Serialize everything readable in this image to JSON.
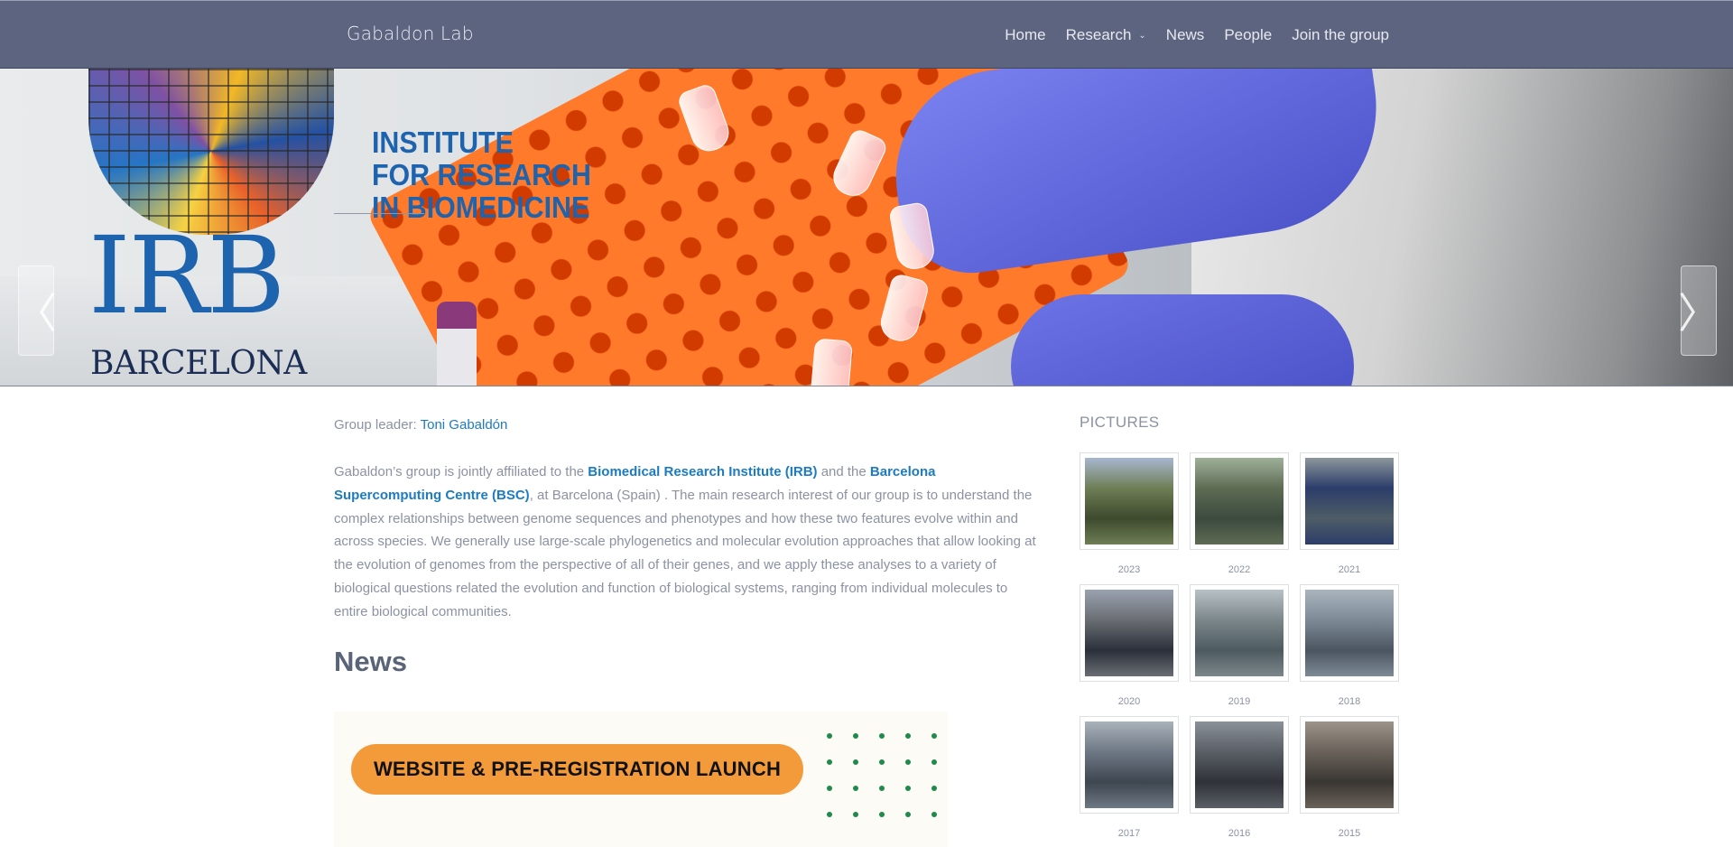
{
  "navbar": {
    "brand": "Gabaldon Lab",
    "items": [
      {
        "label": "Home"
      },
      {
        "label": "Research",
        "has_dropdown": true
      },
      {
        "label": "News"
      },
      {
        "label": "People"
      },
      {
        "label": "Join the group"
      }
    ],
    "dropdown_caret": "⌄",
    "background": "#5c6480"
  },
  "hero": {
    "logo_line1": "INSTITUTE",
    "logo_line2": "FOR RESEARCH",
    "logo_line3": "IN BIOMEDICINE",
    "logo_big": "IRB",
    "logo_city": "BARCELONA",
    "prev_arrow": "〈",
    "next_arrow": "〉"
  },
  "intro": {
    "leader_label": "Group leader: ",
    "leader_name": "Toni Gabaldón",
    "p1": "Gabaldon’s group is jointly affiliated to the ",
    "irb_link": "Biomedical Research Institute (IRB)",
    "p2": " and the ",
    "bsc_link": "Barcelona Supercomputing Centre (BSC)",
    "p3": ", at Barcelona (Spain) . The main research interest of our group is to understand the complex relationships between genome sequences and phenotypes and how these two features evolve within and across species. We generally use large-scale phylogenetics and molecular evolution approaches that allow looking at the evolution of genomes from the perspective of all of their genes, and we apply these analyses to a variety of biological questions related the evolution and function of biological systems, ranging from individual molecules to entire biological communities."
  },
  "news": {
    "title": "News",
    "banner_text": "WEBSITE & PRE-REGISTRATION LAUNCH"
  },
  "pictures": {
    "title": "PICTURES",
    "items": [
      {
        "year": "2023"
      },
      {
        "year": "2022"
      },
      {
        "year": "2021"
      },
      {
        "year": "2020"
      },
      {
        "year": "2019"
      },
      {
        "year": "2018"
      },
      {
        "year": "2017"
      },
      {
        "year": "2016"
      },
      {
        "year": "2015"
      }
    ]
  },
  "colors": {
    "accent_link": "#1b7bc3",
    "banner_orange": "#f39a3b",
    "dot_green": "#1f8a4b",
    "muted_text": "#8b92a3"
  }
}
